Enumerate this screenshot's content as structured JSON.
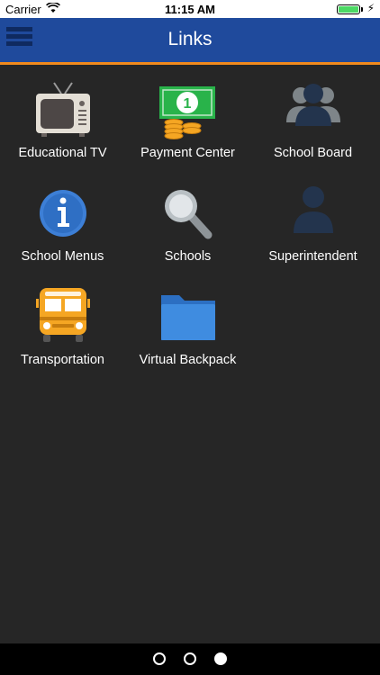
{
  "status": {
    "carrier": "Carrier",
    "time": "11:15 AM"
  },
  "nav": {
    "title": "Links"
  },
  "links": [
    {
      "label": "Educational TV",
      "icon": "tv-icon"
    },
    {
      "label": "Payment Center",
      "icon": "money-icon"
    },
    {
      "label": "School Board",
      "icon": "group-icon"
    },
    {
      "label": "School Menus",
      "icon": "info-icon"
    },
    {
      "label": "Schools",
      "icon": "search-icon"
    },
    {
      "label": "Superintendent",
      "icon": "person-icon"
    },
    {
      "label": "Transportation",
      "icon": "bus-icon"
    },
    {
      "label": "Virtual Backpack",
      "icon": "folder-icon"
    }
  ],
  "pager": {
    "pages": 3,
    "active_page": 3
  },
  "colors": {
    "nav_bar": "#1f4a9c",
    "nav_accent": "#f08a1d",
    "background": "#262626"
  }
}
